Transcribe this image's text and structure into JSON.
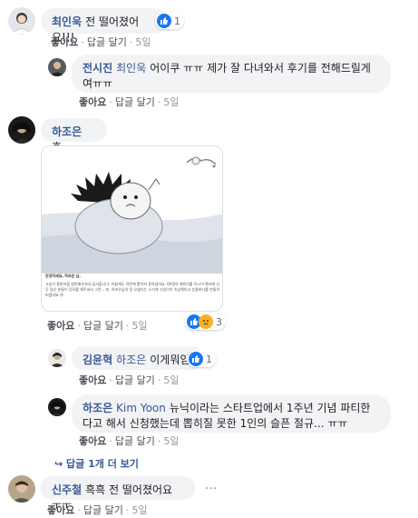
{
  "actions": {
    "like": "좋아요",
    "reply": "답글 달기",
    "time": "5일",
    "separator": "·"
  },
  "comments": [
    {
      "author": "최인욱",
      "text": "전 떨어졌어요!!!",
      "reaction_count": "1"
    },
    {
      "author": "전시진",
      "mention": "최인욱",
      "text": "어이쿠 ㅠㅠ 제가 잘 다녀와서 후기를 전해드릴게여ㅠㅠ"
    },
    {
      "author": "하조은",
      "text": "휴...",
      "reaction_count": "3",
      "card": {
        "heading": "안녕하세요, 하조은 님.",
        "body": "고슴이 들판마을 원반배우셔서 감사합니다. 아쉽게도 이번에 뽑히지 못하셨어요. 60명의 체육미를 모시어 행사에 너무 많은 분들이 응모를 해주셔서 그런... 또, 하조은님의 못 오셨더는 소식에 고슴이가 속상해하고 눈물바다를 만들어 버렸네요 😢"
      }
    },
    {
      "author": "김윤혁",
      "mention": "하조은",
      "text": "이게뭐임",
      "reaction_count": "1"
    },
    {
      "author": "하조은",
      "mention": "Kim Yoon",
      "text": "뉴닉이라는 스타트업에서 1주년 기념 파티한다고 해서 신청했는데 뽑히질 못한 1인의 슬픈 절규... ㅠㅠ"
    },
    {
      "author": "신주철",
      "text": "흑흑 전 떨어졌어요 ㅜㅜ"
    }
  ],
  "more_replies": "답글 1개 더 보기",
  "more_options": "···",
  "colors": {
    "link": "#385898",
    "bubble": "#f2f3f5",
    "like_blue": "#1877f2",
    "meta": "#90949c"
  }
}
